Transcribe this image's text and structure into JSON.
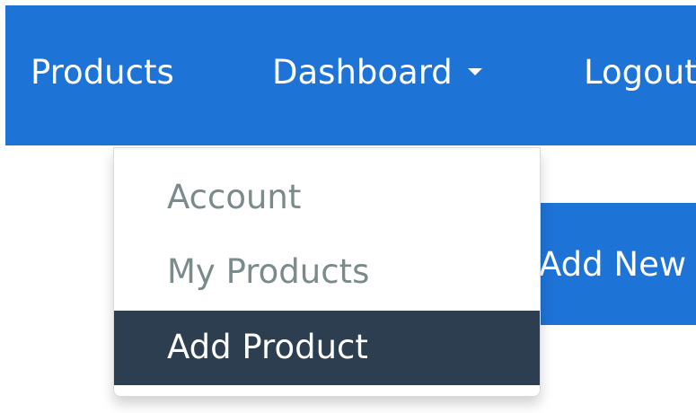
{
  "navbar": {
    "items": [
      {
        "label": "Products"
      },
      {
        "label": "Dashboard"
      },
      {
        "label": "Logout"
      }
    ]
  },
  "dropdown": {
    "items": [
      {
        "label": "Account"
      },
      {
        "label": "My Products"
      },
      {
        "label": "Add Product",
        "active": true
      }
    ]
  },
  "main": {
    "add_new_button_label": "Add New"
  },
  "colors": {
    "nav_background": "#1e73d6",
    "dropdown_active": "#2c3e50",
    "dropdown_text": "#7b8a8b"
  },
  "icons": {
    "dashboard_caret": "chevron-down-icon"
  }
}
